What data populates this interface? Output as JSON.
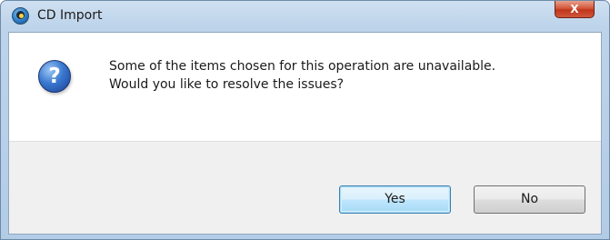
{
  "window": {
    "title": "CD Import",
    "close_label": "X"
  },
  "icons": {
    "app": "cd-import-app-icon",
    "question": "question-icon",
    "question_glyph": "?"
  },
  "message": {
    "line1": "Some of the items chosen for this operation are unavailable.",
    "line2": "Would you like to resolve the issues?"
  },
  "buttons": {
    "yes_label": "Yes",
    "no_label": "No"
  },
  "colors": {
    "title_bar": "#bcd3ea",
    "close_button": "#c0361c",
    "default_button_border": "#3c7fb1",
    "question_icon": "#3a78d0"
  }
}
